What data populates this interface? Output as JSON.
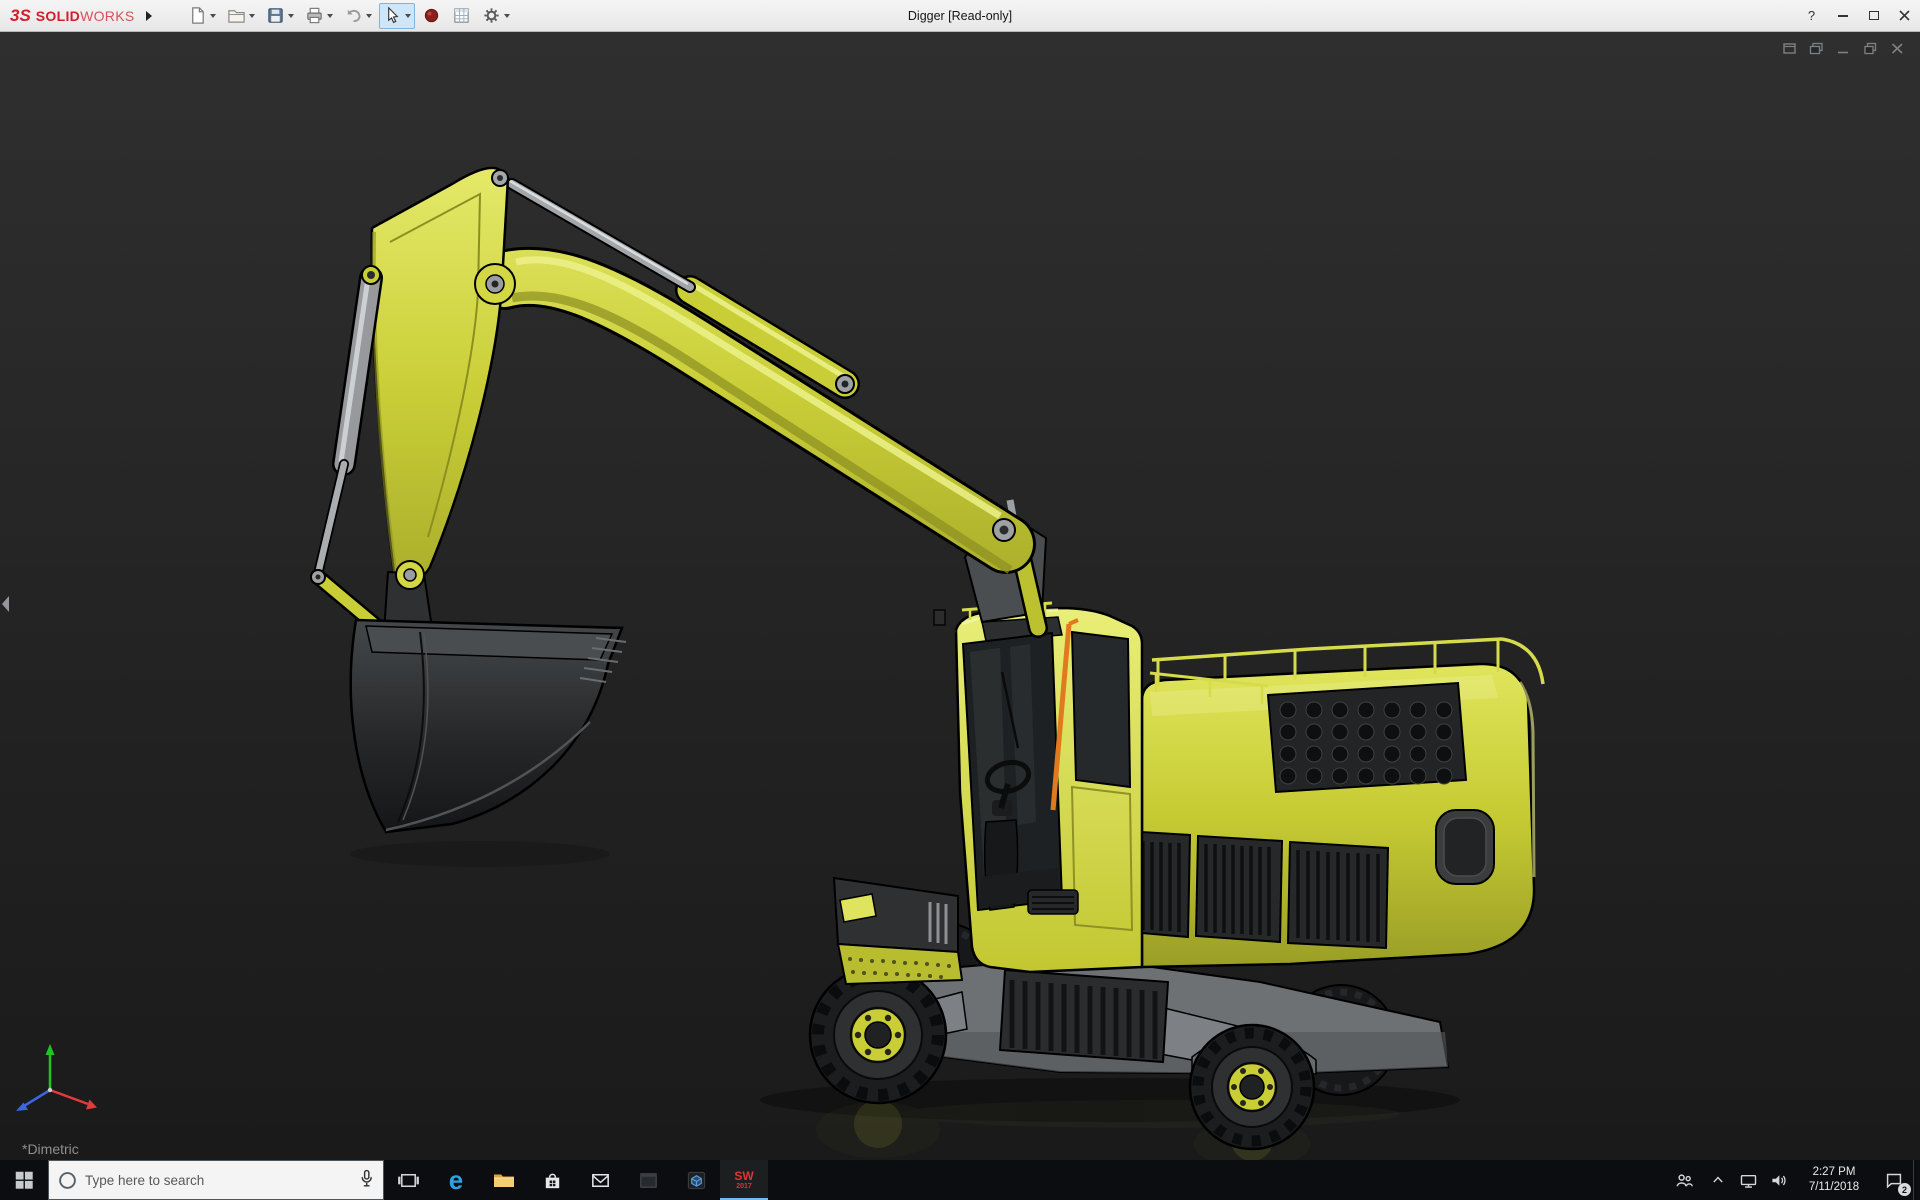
{
  "titlebar": {
    "brand": {
      "mark": "3S",
      "bold": "SOLID",
      "light": "WORKS"
    },
    "document_title": "Digger [Read-only]",
    "controls": {
      "help": "?"
    },
    "toolbar_icons": [
      "new-document",
      "open",
      "save",
      "print",
      "undo",
      "select-arrow",
      "red-sphere",
      "spreadsheet",
      "options-gear"
    ]
  },
  "viewport": {
    "view_orientation": "*Dimetric",
    "doc_window_icons": [
      "new-window",
      "cascade-windows",
      "minimize-document",
      "restore-document",
      "close-document"
    ],
    "triad_icon": "orientation-triad"
  },
  "taskbar": {
    "search_placeholder": "Type here to search",
    "edge_glyph": "e",
    "solidworks_label": "SW",
    "solidworks_year": "2017",
    "action_center_badge": "2",
    "clock": {
      "time": "2:27 PM",
      "date": "7/11/2018"
    },
    "icons": [
      "start",
      "cortana-ring",
      "microphone",
      "task-view",
      "edge",
      "file-explorer",
      "store",
      "mail",
      "dark-app-window",
      "cube-app",
      "solidworks-2017"
    ],
    "tray_icons": [
      "people",
      "hidden-icons-chevron",
      "network",
      "volume",
      "action-center"
    ]
  },
  "colors": {
    "excavator_yellow": "#c9ce37",
    "excavator_yellow_light": "#ecf18b",
    "excavator_yellow_dark": "#8b8f21",
    "metal_gray": "#a4a7aa",
    "dark_part": "#232425",
    "cab_glass": "#1e2123",
    "handrail_orange": "#e07a1e",
    "brand_red": "#d21e2b",
    "viewport_bg": "#242424",
    "taskbar_bg": "#0b0d10",
    "titlebar_bg": "#ececec",
    "select_highlight": "#cfe6f8"
  }
}
